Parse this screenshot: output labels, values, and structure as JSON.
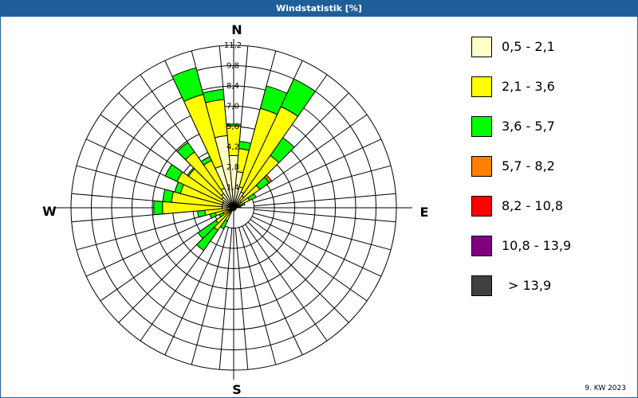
{
  "window": {
    "title": "Windstatistik [%]",
    "footer": "9. KW 2023"
  },
  "chart_data": {
    "type": "wind-rose",
    "title": "Windstatistik [%]",
    "unit": "%",
    "rmax": 11.2,
    "ring_ticks": [
      "1,4",
      "2,8",
      "4,2",
      "5,6",
      "7,0",
      "8,4",
      "9,8",
      "11,2"
    ],
    "ring_values": [
      1.4,
      2.8,
      4.2,
      5.6,
      7.0,
      8.4,
      9.8,
      11.2
    ],
    "compass": {
      "n": "N",
      "e": "E",
      "s": "S",
      "w": "W"
    },
    "classes": [
      {
        "label": "0,5 - 2,1",
        "color": "#ffffc8"
      },
      {
        "label": "2,1 - 3,6",
        "color": "#ffff00"
      },
      {
        "label": "3,6 - 5,7",
        "color": "#00ff00"
      },
      {
        "label": "5,7 - 8,2",
        "color": "#ff8000"
      },
      {
        "label": "8,2 - 10,8",
        "color": "#ff0000"
      },
      {
        "label": "10,8 - 13,9",
        "color": "#800080"
      },
      {
        "label": "> 13,9",
        "color": "#404040"
      }
    ],
    "sector_width_deg": 10,
    "sectors": [
      {
        "dir": 0,
        "values": [
          3.6,
          2.05,
          0.12,
          0
        ]
      },
      {
        "dir": 10,
        "values": [
          2.5,
          1.6,
          0.5,
          0
        ]
      },
      {
        "dir": 20,
        "values": [
          1.5,
          5.6,
          1.6,
          0
        ]
      },
      {
        "dir": 30,
        "values": [
          1.2,
          6.5,
          2.1,
          0
        ]
      },
      {
        "dir": 40,
        "values": [
          1.0,
          3.4,
          1.5,
          0
        ]
      },
      {
        "dir": 50,
        "values": [
          0.6,
          1.6,
          0.8,
          0.2
        ]
      },
      {
        "dir": 60,
        "values": [
          0.4,
          0.8,
          0.5,
          0
        ]
      },
      {
        "dir": 70,
        "values": [
          0.3,
          0.3,
          0.2,
          0
        ]
      },
      {
        "dir": 80,
        "values": [
          0.2,
          0.2,
          0.1,
          0
        ]
      },
      {
        "dir": 210,
        "values": [
          0.2,
          0.8,
          0.6,
          0
        ]
      },
      {
        "dir": 220,
        "values": [
          0.3,
          1.6,
          1.7,
          0
        ]
      },
      {
        "dir": 230,
        "values": [
          0.3,
          1.2,
          1.5,
          0
        ]
      },
      {
        "dir": 240,
        "values": [
          0.2,
          0.6,
          0.3,
          0
        ]
      },
      {
        "dir": 250,
        "values": [
          0.3,
          1.0,
          0.4,
          0
        ]
      },
      {
        "dir": 260,
        "values": [
          0.5,
          1.5,
          0.5,
          0
        ]
      },
      {
        "dir": 270,
        "values": [
          0.8,
          4.1,
          0.6,
          0
        ]
      },
      {
        "dir": 280,
        "values": [
          0.8,
          3.5,
          0.6,
          0
        ]
      },
      {
        "dir": 290,
        "values": [
          0.8,
          3.0,
          0.4,
          0
        ]
      },
      {
        "dir": 300,
        "values": [
          0.8,
          3.5,
          0.9,
          0
        ]
      },
      {
        "dir": 310,
        "values": [
          1.0,
          2.8,
          0.1,
          0
        ]
      },
      {
        "dir": 320,
        "values": [
          1.2,
          3.5,
          0.8,
          0
        ]
      },
      {
        "dir": 330,
        "values": [
          1.5,
          2.1,
          0.3,
          0
        ]
      },
      {
        "dir": 340,
        "values": [
          3.0,
          5.1,
          1.9,
          0
        ]
      },
      {
        "dir": 350,
        "values": [
          5.0,
          2.5,
          0.7,
          0
        ]
      }
    ]
  }
}
